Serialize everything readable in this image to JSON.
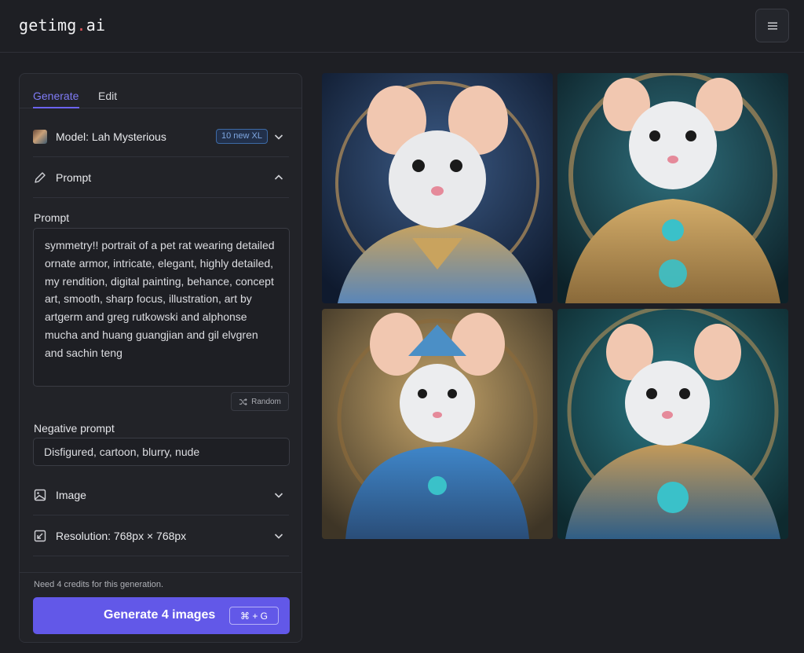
{
  "header": {
    "logo_main": "getimg",
    "logo_dot": ".",
    "logo_tail": "ai",
    "menu_icon": "hamburger-menu-icon"
  },
  "tabs": [
    {
      "label": "Generate",
      "active": true
    },
    {
      "label": "Edit",
      "active": false
    }
  ],
  "model": {
    "label": "Model: Lah Mysterious",
    "badge": "10 new XL"
  },
  "prompt_section": {
    "label": "Prompt"
  },
  "prompt": {
    "label": "Prompt",
    "value": "symmetry!! portrait of a pet rat wearing detailed ornate armor, intricate, elegant, highly detailed, my rendition, digital painting, behance, concept art, smooth, sharp focus, illustration, art by artgerm and greg rutkowski and alphonse mucha and huang guangjian and gil elvgren and sachin teng",
    "random_label": "Random"
  },
  "negative_prompt": {
    "label": "Negative prompt",
    "value": "Disfigured, cartoon, blurry, nude"
  },
  "image_section": {
    "label": "Image"
  },
  "resolution_section": {
    "label": "Resolution: 768px × 768px"
  },
  "footer": {
    "credits_text": "Need 4 credits for this generation.",
    "generate_label": "Generate 4 images",
    "shortcut": "⌘ + G"
  },
  "colors": {
    "accent": "#6258e8",
    "background": "#1e1f24",
    "panel": "#222328",
    "badge": "#7ea6e0"
  },
  "gallery": {
    "images": [
      {
        "name": "generated-image-1"
      },
      {
        "name": "generated-image-2"
      },
      {
        "name": "generated-image-3"
      },
      {
        "name": "generated-image-4"
      }
    ]
  }
}
